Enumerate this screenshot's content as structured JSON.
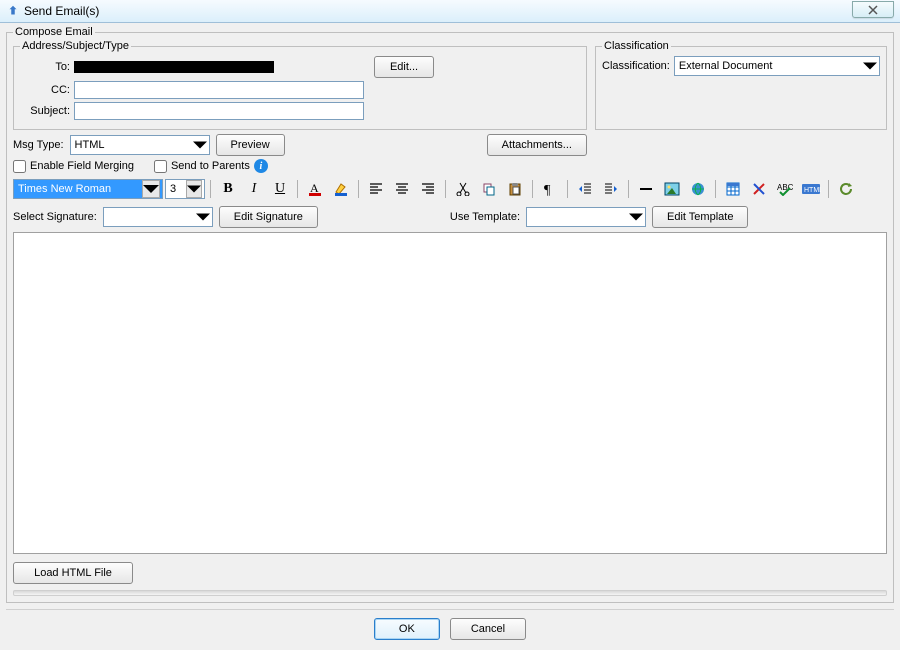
{
  "window": {
    "title": "Send Email(s)"
  },
  "compose_legend": "Compose Email",
  "addr": {
    "legend": "Address/Subject/Type",
    "to_label": "To:",
    "to_value": "",
    "cc_label": "CC:",
    "cc_value": "",
    "subject_label": "Subject:",
    "subject_value": "",
    "edit_btn": "Edit..."
  },
  "classif": {
    "legend": "Classification",
    "label": "Classification:",
    "value": "External Document"
  },
  "msgtype": {
    "label": "Msg Type:",
    "value": "HTML",
    "preview_btn": "Preview",
    "attachments_btn": "Attachments..."
  },
  "options": {
    "enable_merge": "Enable Field Merging",
    "send_parents": "Send to Parents"
  },
  "toolbar": {
    "font": "Times New Roman",
    "size": "3"
  },
  "sig": {
    "select_label": "Select Signature:",
    "select_value": "",
    "edit_btn": "Edit Signature",
    "tmpl_label": "Use Template:",
    "tmpl_value": "",
    "edit_tmpl_btn": "Edit Template"
  },
  "load_btn": "Load HTML File",
  "ok": "OK",
  "cancel": "Cancel"
}
